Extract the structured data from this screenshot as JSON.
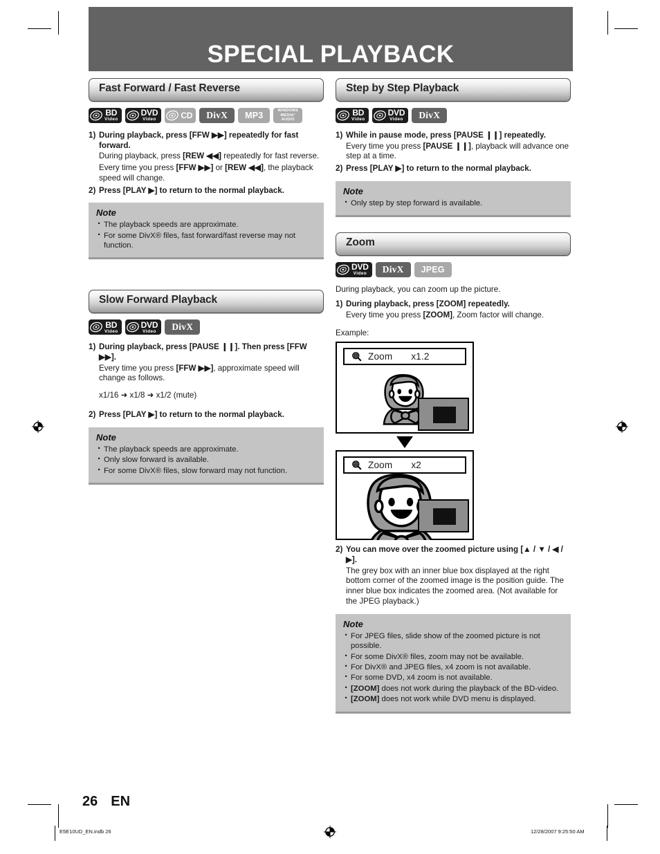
{
  "document": {
    "title": "SPECIAL PLAYBACK",
    "page_number": "26",
    "language_code": "EN",
    "slug_left": "E5E10UD_EN.indb   26",
    "slug_right": "12/28/2007   9:25:50 AM"
  },
  "sections": {
    "fast_forward": {
      "heading": "Fast Forward / Fast Reverse",
      "badges": [
        {
          "kind": "disc",
          "main": "BD",
          "sub": "Video",
          "tone": "dark"
        },
        {
          "kind": "disc",
          "main": "DVD",
          "sub": "Video",
          "tone": "dark"
        },
        {
          "kind": "disc-cd",
          "main": "CD",
          "tone": "light"
        },
        {
          "kind": "text",
          "label": "DivX",
          "tone": "mid",
          "style": "serif"
        },
        {
          "kind": "text",
          "label": "MP3",
          "tone": "light"
        },
        {
          "kind": "wma",
          "line1": "WINDOWS",
          "line2": "MEDIA°",
          "line3": "AUDIO",
          "tone": "light"
        }
      ],
      "step1_num": "1)",
      "step1": "During playback, press [FFW ▶▶] repeatedly for fast forward.",
      "para1_a": "During playback, press ",
      "para1_b": "[REW ◀◀]",
      "para1_c": " repeatedly for fast reverse.",
      "para2_a": "Every time you press ",
      "para2_b": "[FFW ▶▶]",
      "para2_c": " or ",
      "para2_d": "[REW ◀◀]",
      "para2_e": ", the playback speed will change.",
      "step2_num": "2)",
      "step2": "Press [PLAY ▶] to return to the normal playback.",
      "note_title": "Note",
      "notes": [
        "The playback speeds are approximate.",
        "For some DivX® files, fast forward/fast reverse may not function."
      ]
    },
    "slow_forward": {
      "heading": "Slow Forward Playback",
      "badges": [
        {
          "kind": "disc",
          "main": "BD",
          "sub": "Video",
          "tone": "dark"
        },
        {
          "kind": "disc",
          "main": "DVD",
          "sub": "Video",
          "tone": "dark"
        },
        {
          "kind": "text",
          "label": "DivX",
          "tone": "mid",
          "style": "serif"
        }
      ],
      "step1_num": "1)",
      "step1": "During playback, press [PAUSE ❙❙]. Then press [FFW ▶▶].",
      "para1_a": "Every time you press ",
      "para1_b": "[FFW ▶▶]",
      "para1_c": ", approximate speed will change as follows.",
      "speed_sequence": "x1/16 ➜ x1/8 ➜ x1/2 (mute)",
      "step2_num": "2)",
      "step2": "Press [PLAY ▶] to return to the normal playback.",
      "note_title": "Note",
      "notes": [
        "The playback speeds are approximate.",
        "Only slow forward is available.",
        "For some DivX® files, slow forward may not function."
      ]
    },
    "step_by_step": {
      "heading": "Step by Step Playback",
      "badges": [
        {
          "kind": "disc",
          "main": "BD",
          "sub": "Video",
          "tone": "dark"
        },
        {
          "kind": "disc",
          "main": "DVD",
          "sub": "Video",
          "tone": "dark"
        },
        {
          "kind": "text",
          "label": "DivX",
          "tone": "mid",
          "style": "serif"
        }
      ],
      "step1_num": "1)",
      "step1": "While in pause mode, press [PAUSE ❙❙] repeatedly.",
      "para1_a": "Every time you press ",
      "para1_b": "[PAUSE ❙❙]",
      "para1_c": ", playback will advance one step at a time.",
      "step2_num": "2)",
      "step2": "Press [PLAY ▶] to return to the normal playback.",
      "note_title": "Note",
      "notes": [
        "Only step by step forward is available."
      ]
    },
    "zoom": {
      "heading": "Zoom",
      "badges": [
        {
          "kind": "disc",
          "main": "DVD",
          "sub": "Video",
          "tone": "dark"
        },
        {
          "kind": "text",
          "label": "DivX",
          "tone": "mid",
          "style": "serif"
        },
        {
          "kind": "text",
          "label": "JPEG",
          "tone": "light"
        }
      ],
      "intro": "During playback, you can zoom up the picture.",
      "step1_num": "1)",
      "step1": "During playback, press [ZOOM] repeatedly.",
      "para1_a": "Every time you press ",
      "para1_b": "[ZOOM]",
      "para1_c": ", Zoom factor will change.",
      "example_label": "Example:",
      "osd1_label": "Zoom",
      "osd1_value": "x1.2",
      "osd2_label": "Zoom",
      "osd2_value": "x2",
      "step2_num": "2)",
      "step2": "You can move over the zoomed picture using [▲ / ▼ / ◀ / ▶].",
      "para2": "The grey box with an inner blue box displayed at the right bottom corner of the zoomed image is the position guide. The inner blue box indicates the zoomed area. (Not available for the JPEG playback.)",
      "note_title": "Note",
      "notes": [
        "For JPEG files, slide show of the zoomed picture is not possible.",
        "For some DivX® files, zoom may not be available.",
        "For DivX® and JPEG files, x4 zoom is not available.",
        "For some DVD, x4 zoom is not available."
      ],
      "note_zoom_bold": "[ZOOM]",
      "note_zoom_rest1": " does not work during the playback of the BD-video.",
      "note_zoom_rest2": " does not work while DVD menu is displayed."
    }
  },
  "colors": {
    "banner": "#636363",
    "badge_dark": "#1c1c1c",
    "badge_mid": "#636363",
    "badge_light": "#a8a8a8",
    "note_bg": "#c4c4c4",
    "note_edge": "#9a9a9a"
  }
}
